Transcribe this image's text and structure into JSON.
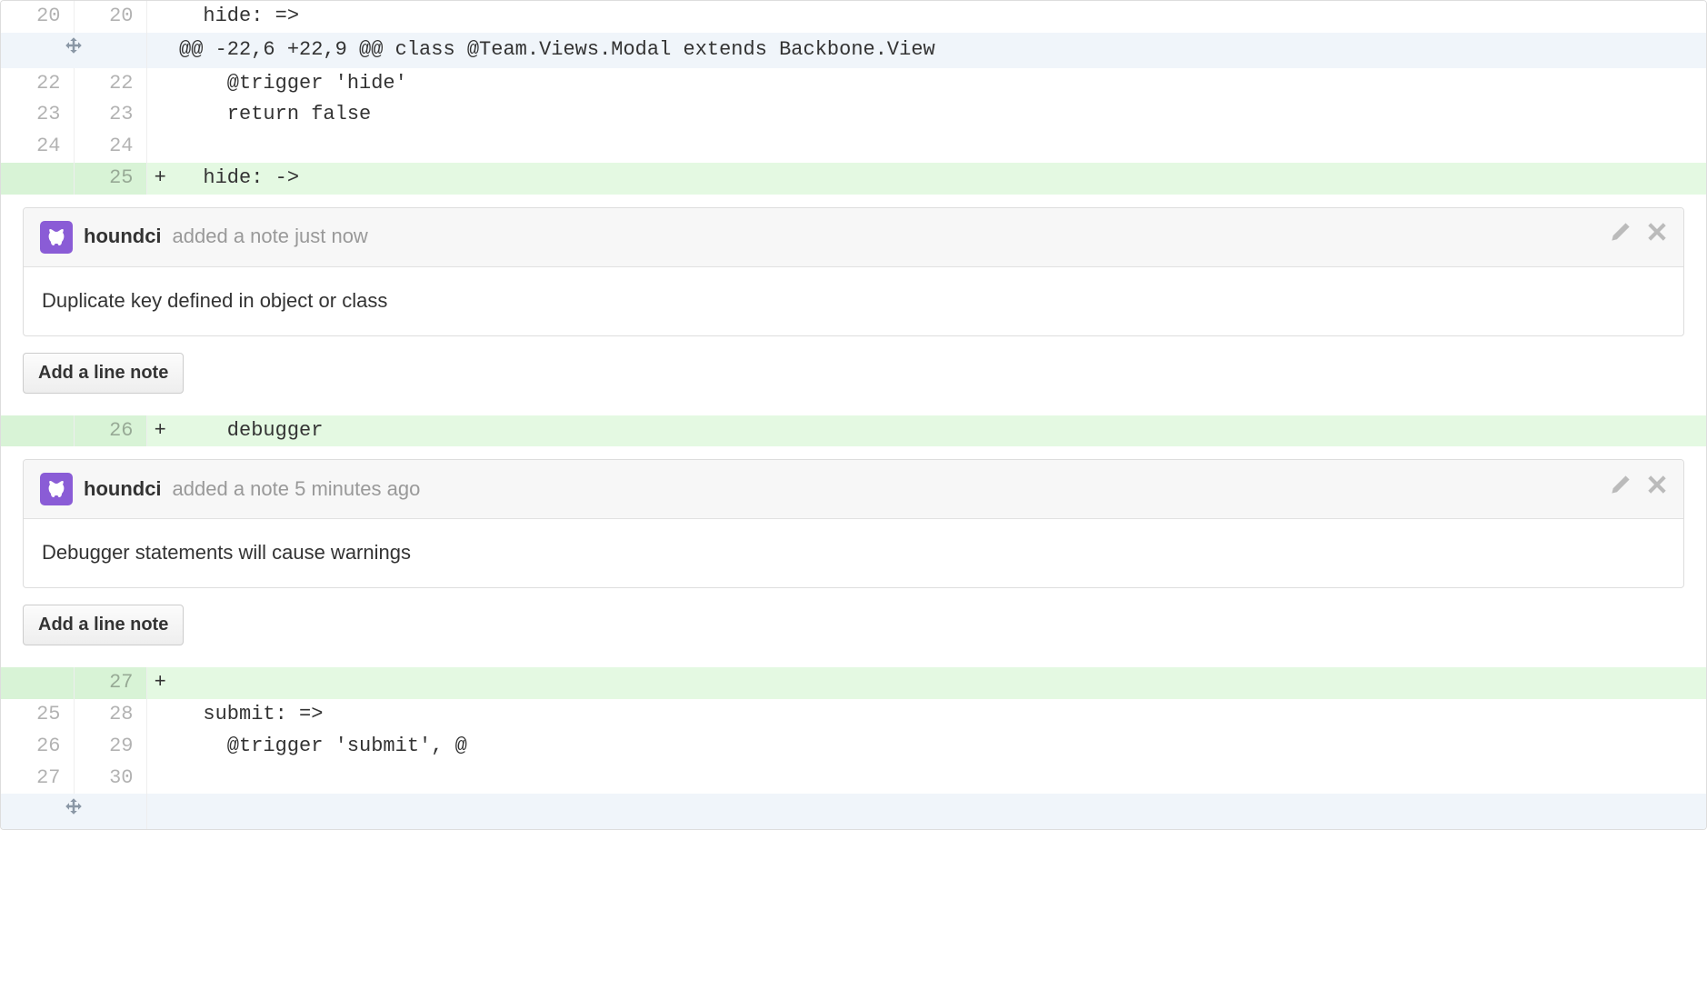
{
  "lines": {
    "l0": {
      "old": "20",
      "new": "20",
      "code": "  hide: =>"
    },
    "hunk1": {
      "text": "@@ -22,6 +22,9 @@ class @Team.Views.Modal extends Backbone.View"
    },
    "l1": {
      "old": "22",
      "new": "22",
      "code": "    @trigger 'hide'"
    },
    "l2": {
      "old": "23",
      "new": "23",
      "code": "    return false"
    },
    "l3": {
      "old": "24",
      "new": "24",
      "code": ""
    },
    "l4": {
      "old": "",
      "new": "25",
      "sign": "+",
      "code": "  hide: ->"
    },
    "l5": {
      "old": "",
      "new": "26",
      "sign": "+",
      "code": "    debugger"
    },
    "l6": {
      "old": "",
      "new": "27",
      "sign": "+",
      "code": ""
    },
    "l7": {
      "old": "25",
      "new": "28",
      "code": "  submit: =>"
    },
    "l8": {
      "old": "26",
      "new": "29",
      "code": "    @trigger 'submit', @"
    },
    "l9": {
      "old": "27",
      "new": "30",
      "code": ""
    }
  },
  "comments": {
    "c1": {
      "author": "houndci",
      "meta": "added a note just now",
      "body": "Duplicate key defined in object or class"
    },
    "c2": {
      "author": "houndci",
      "meta": "added a note 5 minutes ago",
      "body": "Debugger statements will cause warnings"
    }
  },
  "buttons": {
    "add_note": "Add a line note"
  }
}
